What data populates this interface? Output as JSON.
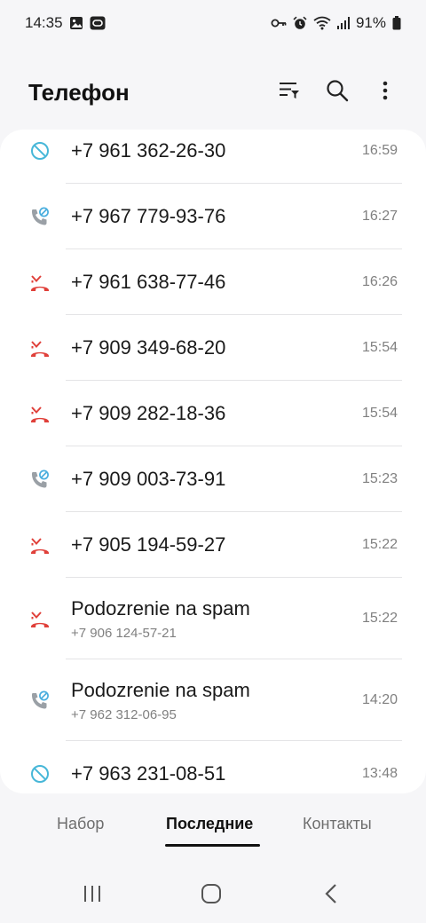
{
  "status_bar": {
    "time": "14:35",
    "battery": "91%",
    "left_icons": [
      "gallery-icon",
      "screen-record-icon"
    ],
    "right_icons": [
      "key-icon",
      "alarm-icon",
      "wifi-icon",
      "signal-icon",
      "battery-icon"
    ]
  },
  "header": {
    "title": "Телефон",
    "actions": [
      "filter-icon",
      "search-icon",
      "more-options-icon"
    ]
  },
  "colors": {
    "missed": "#e0403a",
    "blocked": "#47b7d8",
    "rejected_outgoing": "#9aa0a6",
    "rejected_badge": "#4aaede"
  },
  "calls": [
    {
      "type": "blocked",
      "icon": "blocked-icon",
      "primary": "+7 961 362-26-30",
      "secondary": "",
      "time": "16:59"
    },
    {
      "type": "rejected",
      "icon": "rejected-call-icon",
      "primary": "+7 967 779-93-76",
      "secondary": "",
      "time": "16:27"
    },
    {
      "type": "missed",
      "icon": "missed-call-icon",
      "primary": "+7 961 638-77-46",
      "secondary": "",
      "time": "16:26"
    },
    {
      "type": "missed",
      "icon": "missed-call-icon",
      "primary": "+7 909 349-68-20",
      "secondary": "",
      "time": "15:54"
    },
    {
      "type": "missed",
      "icon": "missed-call-icon",
      "primary": "+7 909 282-18-36",
      "secondary": "",
      "time": "15:54"
    },
    {
      "type": "rejected",
      "icon": "rejected-call-icon",
      "primary": "+7 909 003-73-91",
      "secondary": "",
      "time": "15:23"
    },
    {
      "type": "missed",
      "icon": "missed-call-icon",
      "primary": "+7 905 194-59-27",
      "secondary": "",
      "time": "15:22"
    },
    {
      "type": "missed",
      "icon": "missed-call-icon",
      "primary": "Podozrenie na spam",
      "secondary": "+7 906 124-57-21",
      "time": "15:22"
    },
    {
      "type": "rejected",
      "icon": "rejected-call-icon",
      "primary": "Podozrenie na spam",
      "secondary": "+7 962 312-06-95",
      "time": "14:20"
    },
    {
      "type": "blocked",
      "icon": "blocked-icon",
      "primary": "+7 963 231-08-51",
      "secondary": "",
      "time": "13:48"
    }
  ],
  "tabs": [
    {
      "label": "Набор",
      "active": false
    },
    {
      "label": "Последние",
      "active": true
    },
    {
      "label": "Контакты",
      "active": false
    }
  ],
  "nav_bar": [
    "recent-apps-icon",
    "home-icon",
    "back-icon"
  ]
}
